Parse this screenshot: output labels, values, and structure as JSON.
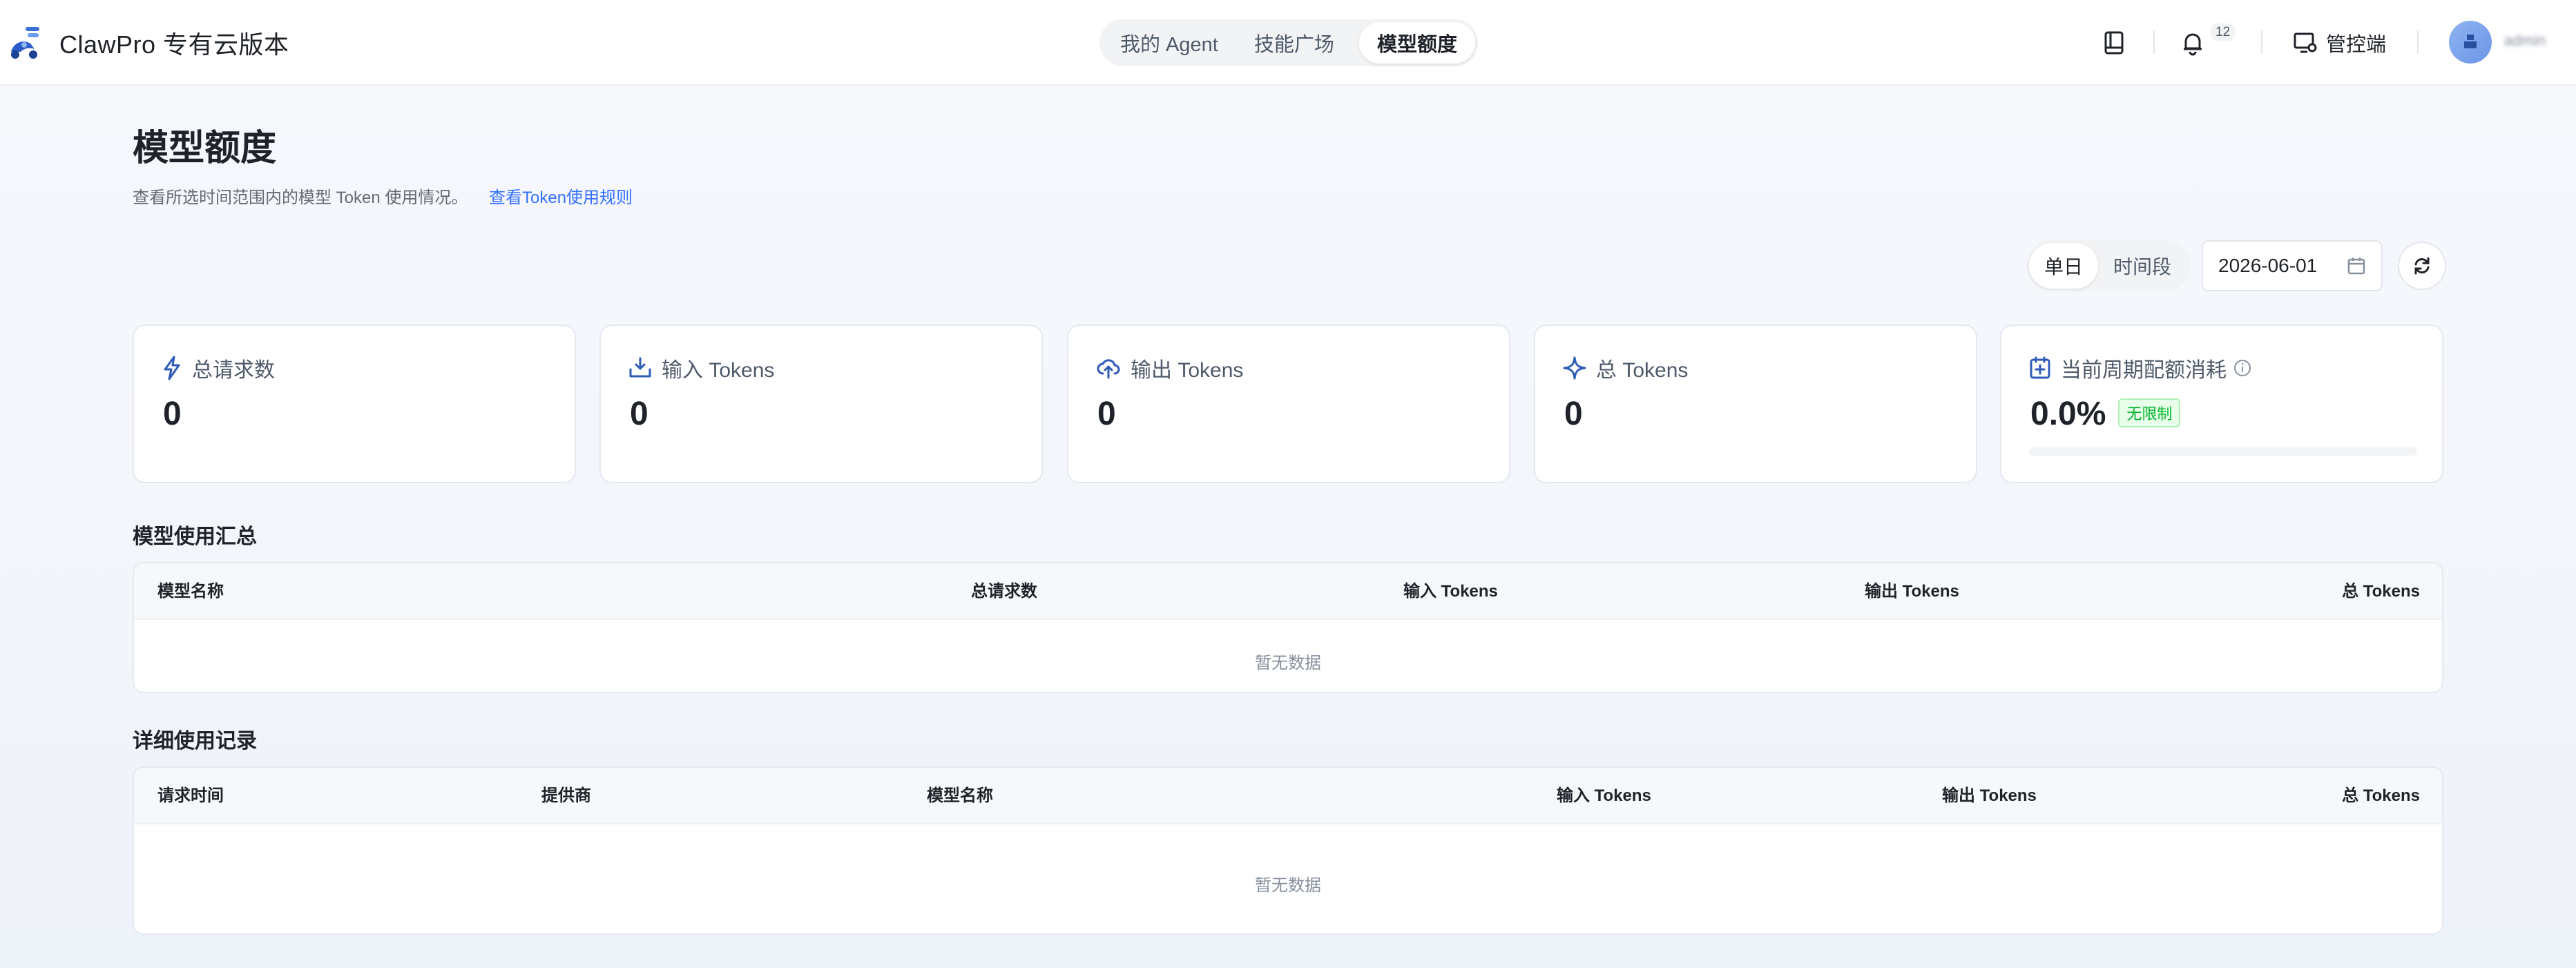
{
  "app": {
    "title": "ClawPro 专有云版本",
    "nav_tabs": [
      {
        "label": "我的 Agent",
        "active": false
      },
      {
        "label": "技能广场",
        "active": false
      },
      {
        "label": "模型额度",
        "active": true
      }
    ],
    "notification_count": "12",
    "admin_label": "管控端",
    "username": "admin"
  },
  "page": {
    "title": "模型额度",
    "description": "查看所选时间范围内的模型 Token 使用情况。",
    "rules_link": "查看Token使用规则"
  },
  "filters": {
    "mode_options": [
      "单日",
      "时间段"
    ],
    "selected_mode": "单日",
    "date": "2026-06-01"
  },
  "stats": [
    {
      "label": "总请求数",
      "value": "0",
      "icon": "lightning-icon"
    },
    {
      "label": "输入 Tokens",
      "value": "0",
      "icon": "inbox-download-icon"
    },
    {
      "label": "输出 Tokens",
      "value": "0",
      "icon": "cloud-upload-icon"
    },
    {
      "label": "总 Tokens",
      "value": "0",
      "icon": "sparkle-icon"
    },
    {
      "label": "当前周期配额消耗",
      "value": "0.0%",
      "tag": "无限制",
      "progress": 0.0,
      "icon": "calendar-plus-icon"
    }
  ],
  "summary": {
    "title": "模型使用汇总",
    "columns": [
      "模型名称",
      "总请求数",
      "输入 Tokens",
      "输出 Tokens",
      "总 Tokens"
    ],
    "rows": [],
    "empty_text": "暂无数据"
  },
  "details": {
    "title": "详细使用记录",
    "columns": [
      "请求时间",
      "提供商",
      "模型名称",
      "输入 Tokens",
      "输出 Tokens",
      "总 Tokens"
    ],
    "rows": [],
    "empty_text": "暂无数据"
  },
  "colors": {
    "primary": "#3370ff",
    "success_tag": "#00b42a",
    "icon_accent": "#2f5bb7"
  }
}
